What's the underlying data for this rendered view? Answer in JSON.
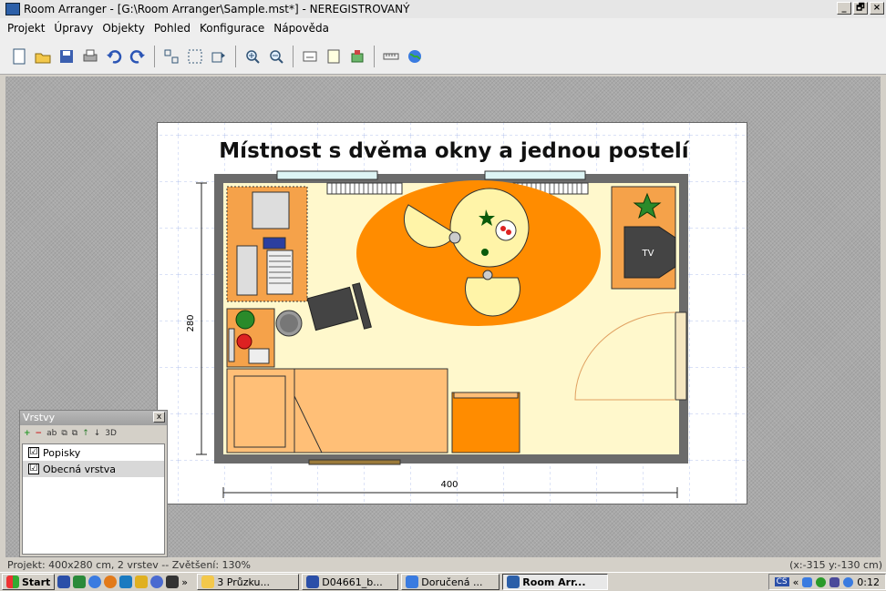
{
  "window": {
    "title": "Room Arranger - [G:\\Room Arranger\\Sample.mst*] - NEREGISTROVANÝ",
    "controls": [
      "_",
      "🗗",
      "×"
    ]
  },
  "menu": [
    "Projekt",
    "Úpravy",
    "Objekty",
    "Pohled",
    "Konfigurace",
    "Nápověda"
  ],
  "toolbar": {
    "icons": [
      "new-icon",
      "open-icon",
      "save-icon",
      "print-icon",
      "undo-icon",
      "redo-icon",
      "sep",
      "align-icon",
      "group-icon",
      "rotate-icon",
      "sep",
      "zoom-in-icon",
      "zoom-out-icon",
      "sep",
      "export-icon",
      "document-icon",
      "object-icon",
      "sep",
      "ruler-icon",
      "globe-icon"
    ]
  },
  "plan": {
    "title": "Místnost s dvěma okny a jednou postelí",
    "height_label": "280",
    "width_label": "400",
    "tv_label": "TV",
    "colors": {
      "floor": "#fff8cc",
      "wall": "#6b6b6b",
      "carpet": "#ff8c00",
      "table": "#fff4a8",
      "bed": "#ffbf77",
      "desk": "#f5a24a"
    }
  },
  "layers": {
    "title": "Vrstvy",
    "close": "x",
    "tools": [
      "+",
      "−",
      "ab",
      "⧉",
      "⧉",
      "↑",
      "↓",
      "3D"
    ],
    "items": [
      {
        "label": "Popisky",
        "checked": "☑"
      },
      {
        "label": "Obecná vrstva",
        "checked": "☑"
      }
    ]
  },
  "status": {
    "left": "Projekt: 400x280 cm, 2 vrstev -- Zvětšení: 130%",
    "right": "(x:-315 y:-130 cm)"
  },
  "taskbar": {
    "start": "Start",
    "tasks": [
      {
        "label": "3 Průzku...",
        "active": false
      },
      {
        "label": "D04661_b...",
        "active": false
      },
      {
        "label": "Doručená ...",
        "active": false
      },
      {
        "label": "Room Arr...",
        "active": true
      }
    ],
    "lang": "CS",
    "chevron": "«",
    "overflow": "»",
    "clock": "0:12"
  }
}
